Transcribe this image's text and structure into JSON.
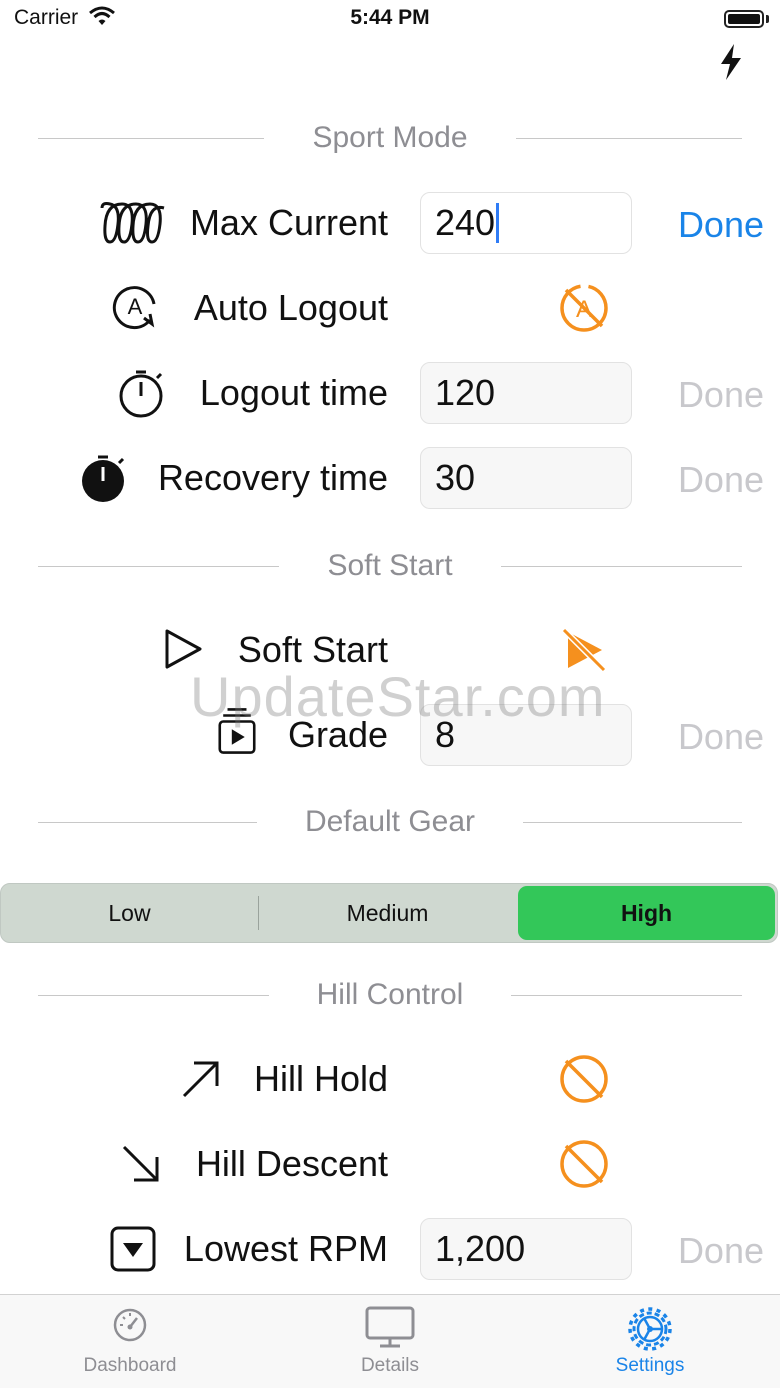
{
  "status_bar": {
    "carrier": "Carrier",
    "time": "5:44 PM"
  },
  "sections": {
    "sport_mode": "Sport Mode",
    "soft_start": "Soft Start",
    "default_gear": "Default Gear",
    "hill_control": "Hill Control"
  },
  "rows": {
    "max_current": {
      "label": "Max Current",
      "value": "240",
      "done": "Done"
    },
    "auto_logout": {
      "label": "Auto Logout"
    },
    "logout_time": {
      "label": "Logout time",
      "value": "120",
      "done": "Done"
    },
    "recovery_time": {
      "label": "Recovery time",
      "value": "30",
      "done": "Done"
    },
    "soft_start": {
      "label": "Soft Start"
    },
    "grade": {
      "label": "Grade",
      "value": "8",
      "done": "Done"
    },
    "hill_hold": {
      "label": "Hill Hold"
    },
    "hill_descent": {
      "label": "Hill Descent"
    },
    "lowest_rpm": {
      "label": "Lowest RPM",
      "value": "1,200",
      "done": "Done"
    }
  },
  "gear_segment": {
    "options": [
      "Low",
      "Medium",
      "High"
    ],
    "selected": "High"
  },
  "watermark": "UpdateStar.com",
  "tabs": [
    {
      "label": "Dashboard",
      "icon": "speedometer-icon"
    },
    {
      "label": "Details",
      "icon": "monitor-icon"
    },
    {
      "label": "Settings",
      "icon": "gear-icon"
    }
  ],
  "selected_tab": "Settings",
  "colors": {
    "accent": "#1a84e8",
    "toggle_off": "#f5901e",
    "selected_segment": "#33c759"
  }
}
